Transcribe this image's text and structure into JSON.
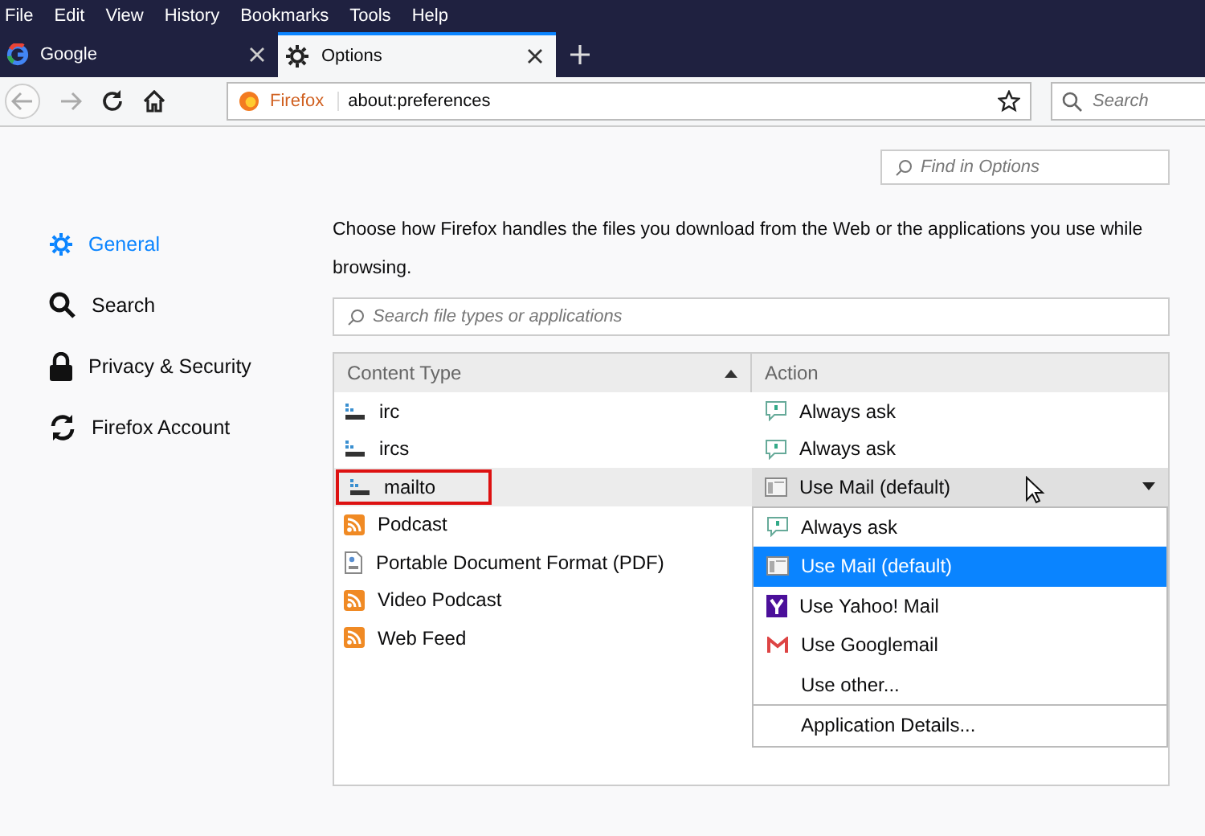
{
  "menu_bar": [
    "File",
    "Edit",
    "View",
    "History",
    "Bookmarks",
    "Tools",
    "Help"
  ],
  "tabs": [
    {
      "label": "Google",
      "selected": false
    },
    {
      "label": "Options",
      "selected": true
    }
  ],
  "address_bar": {
    "identity": "Firefox",
    "url": "about:preferences"
  },
  "search_bar": {
    "placeholder": "Search"
  },
  "find_in_options": {
    "placeholder": "Find in Options"
  },
  "sidebar": {
    "items": [
      {
        "label": "General",
        "selected": true
      },
      {
        "label": "Search",
        "selected": false
      },
      {
        "label": "Privacy & Security",
        "selected": false
      },
      {
        "label": "Firefox Account",
        "selected": false
      }
    ]
  },
  "description": "Choose how Firefox handles the files you download from the Web or the applications you use while browsing.",
  "type_search": {
    "placeholder": "Search file types or applications"
  },
  "table": {
    "columns": [
      {
        "label": "Content Type",
        "sorted": true
      },
      {
        "label": "Action",
        "sorted": false
      }
    ],
    "rows": [
      {
        "type": "irc",
        "kind": "protocol",
        "action": {
          "label": "Always ask",
          "kind": "ask"
        },
        "selected": false,
        "annotated": false
      },
      {
        "type": "ircs",
        "kind": "protocol",
        "action": {
          "label": "Always ask",
          "kind": "ask"
        },
        "selected": false,
        "annotated": false
      },
      {
        "type": "mailto",
        "kind": "protocol",
        "action": {
          "label": "Use Mail (default)",
          "kind": "mail"
        },
        "selected": true,
        "annotated": true,
        "dropdown": [
          {
            "label": "Always ask",
            "kind": "ask",
            "selected": false,
            "separated": false
          },
          {
            "label": "Use Mail (default)",
            "kind": "mail",
            "selected": true,
            "separated": false
          },
          {
            "label": "Use Yahoo! Mail",
            "kind": "yahoo",
            "selected": false,
            "separated": false
          },
          {
            "label": "Use Googlemail",
            "kind": "gmail",
            "selected": false,
            "separated": false
          },
          {
            "label": "Use other...",
            "kind": "plain",
            "selected": false,
            "separated": false
          },
          {
            "label": "Application Details...",
            "kind": "plain",
            "selected": false,
            "separated": true
          }
        ]
      },
      {
        "type": "Podcast",
        "kind": "feed",
        "selected": false,
        "annotated": false
      },
      {
        "type": "Portable Document Format (PDF)",
        "kind": "pdf",
        "selected": false,
        "annotated": false
      },
      {
        "type": "Video Podcast",
        "kind": "feed",
        "selected": false,
        "annotated": false
      },
      {
        "type": "Web Feed",
        "kind": "feed",
        "selected": false,
        "annotated": false
      }
    ]
  }
}
